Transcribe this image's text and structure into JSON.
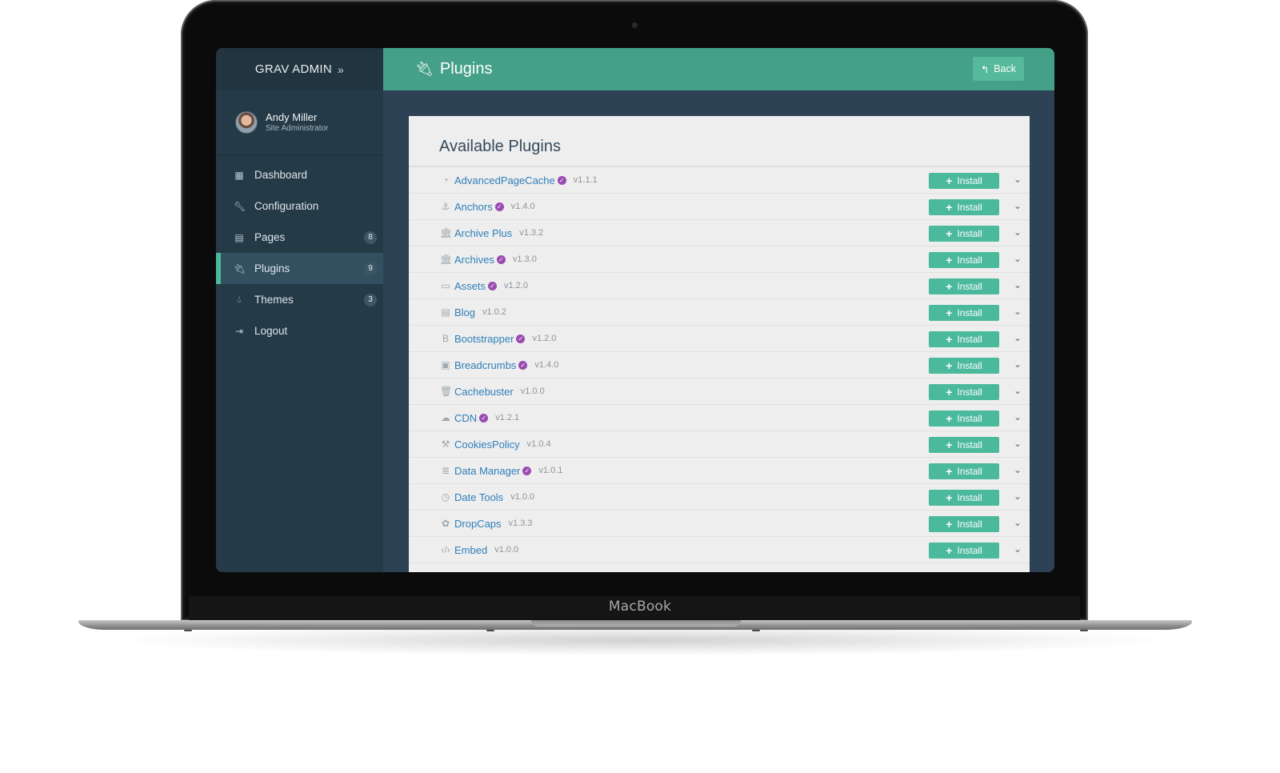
{
  "device": {
    "brand": "MacBook"
  },
  "sidebar": {
    "brand": "GRAV ADMIN",
    "user": {
      "name": "Andy Miller",
      "role": "Site Administrator"
    },
    "items": [
      {
        "label": "Dashboard",
        "icon": "dashboard-icon",
        "badge": ""
      },
      {
        "label": "Configuration",
        "icon": "wrench-icon",
        "badge": ""
      },
      {
        "label": "Pages",
        "icon": "file-icon",
        "badge": "8"
      },
      {
        "label": "Plugins",
        "icon": "plug-icon",
        "badge": "9",
        "active": true
      },
      {
        "label": "Themes",
        "icon": "tint-icon",
        "badge": "3"
      },
      {
        "label": "Logout",
        "icon": "sign-out-icon",
        "badge": ""
      }
    ]
  },
  "header": {
    "title": "Plugins",
    "back_label": "Back"
  },
  "panel": {
    "title": "Available Plugins",
    "install_label": "Install",
    "plugins": [
      {
        "name": "AdvancedPageCache",
        "version": "v1.1.1",
        "verified": true,
        "icon": "tachometer-icon"
      },
      {
        "name": "Anchors",
        "version": "v1.4.0",
        "verified": true,
        "icon": "anchor-icon"
      },
      {
        "name": "Archive Plus",
        "version": "v1.3.2",
        "verified": false,
        "icon": "university-icon"
      },
      {
        "name": "Archives",
        "version": "v1.3.0",
        "verified": true,
        "icon": "university-icon"
      },
      {
        "name": "Assets",
        "version": "v1.2.0",
        "verified": true,
        "icon": "list-alt-icon"
      },
      {
        "name": "Blog",
        "version": "v1.0.2",
        "verified": false,
        "icon": "file-text-icon"
      },
      {
        "name": "Bootstrapper",
        "version": "v1.2.0",
        "verified": true,
        "icon": "bold-icon"
      },
      {
        "name": "Breadcrumbs",
        "version": "v1.4.0",
        "verified": true,
        "icon": "caret-square-icon"
      },
      {
        "name": "Cachebuster",
        "version": "v1.0.0",
        "verified": false,
        "icon": "trash-icon"
      },
      {
        "name": "CDN",
        "version": "v1.2.1",
        "verified": true,
        "icon": "cloud-icon"
      },
      {
        "name": "CookiesPolicy",
        "version": "v1.0.4",
        "verified": false,
        "icon": "gavel-icon"
      },
      {
        "name": "Data Manager",
        "version": "v1.0.1",
        "verified": true,
        "icon": "database-icon"
      },
      {
        "name": "Date Tools",
        "version": "v1.0.0",
        "verified": false,
        "icon": "clock-icon"
      },
      {
        "name": "DropCaps",
        "version": "v1.3.3",
        "verified": false,
        "icon": "paw-icon"
      },
      {
        "name": "Embed",
        "version": "v1.0.0",
        "verified": false,
        "icon": "code-icon"
      }
    ]
  },
  "colors": {
    "sidebar": "#253a47",
    "header": "#45a088",
    "accent": "#4bb99b",
    "link": "#2f7fb8",
    "verified": "#9a4bb2"
  }
}
